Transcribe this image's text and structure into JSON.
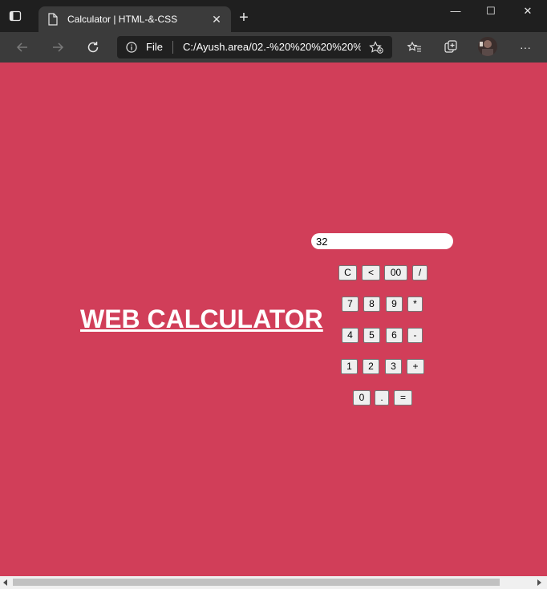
{
  "browser": {
    "tab_title": "Calculator | HTML-&-CSS",
    "tab_close": "✕",
    "new_tab": "+",
    "window": {
      "minimize": "—",
      "maximize": "☐",
      "close": "✕"
    },
    "scheme_label": "File",
    "url": "C:/Ayush.area/02.-%20%20%20%20%20%20",
    "more": "···"
  },
  "page": {
    "heading": "WEB CALCULATOR",
    "background": "#d13e59"
  },
  "calculator": {
    "display_value": "32",
    "keys": {
      "clear": "C",
      "backspace": "<",
      "double_zero": "00",
      "divide": "/",
      "seven": "7",
      "eight": "8",
      "nine": "9",
      "multiply": "*",
      "four": "4",
      "five": "5",
      "six": "6",
      "minus": "-",
      "one": "1",
      "two": "2",
      "three": "3",
      "plus": "+",
      "zero": "0",
      "dot": ".",
      "equals": "="
    }
  }
}
